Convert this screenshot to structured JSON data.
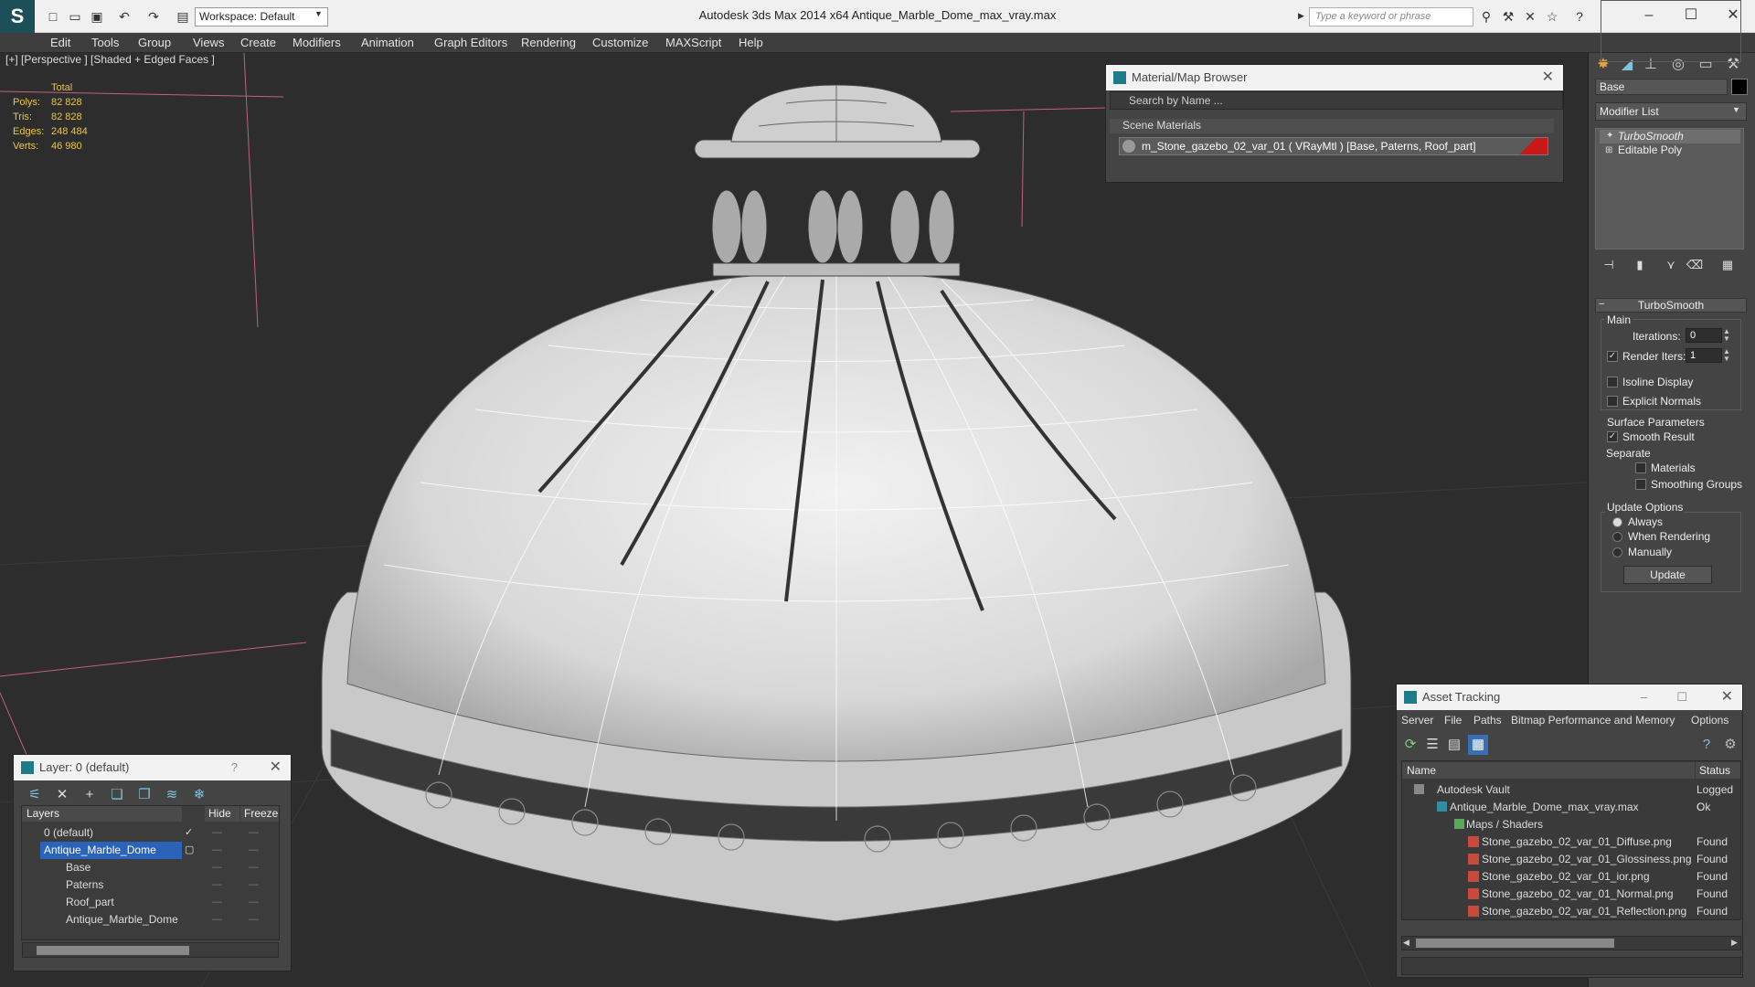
{
  "titlebar": {
    "title": "Autodesk 3ds Max  2014 x64     Antique_Marble_Dome_max_vray.max",
    "workspace": "Workspace: Default",
    "search_placeholder": "Type a keyword or phrase"
  },
  "menu": [
    "Edit",
    "Tools",
    "Group",
    "Views",
    "Create",
    "Modifiers",
    "Animation",
    "Graph Editors",
    "Rendering",
    "Customize",
    "MAXScript",
    "Help"
  ],
  "viewport": {
    "label": "[+] [Perspective ] [Shaded + Edged Faces ]",
    "stats": {
      "header": "Total",
      "rows": [
        {
          "label": "Polys:",
          "value": "82 828"
        },
        {
          "label": "Tris:",
          "value": "82 828"
        },
        {
          "label": "Edges:",
          "value": "248 484"
        },
        {
          "label": "Verts:",
          "value": "46 980"
        }
      ]
    }
  },
  "material_browser": {
    "title": "Material/Map Browser",
    "search_placeholder": "Search by Name ...",
    "section": "Scene Materials",
    "material": "m_Stone_gazebo_02_var_01  ( VRayMtl ) [Base, Paterns, Roof_part]",
    "swatch_color": "#c81818"
  },
  "command_panel": {
    "object_name": "Base",
    "modifier_list": "Modifier List",
    "stack": [
      "TurboSmooth",
      "Editable Poly"
    ],
    "rollout": "TurboSmooth",
    "main_group": "Main",
    "iterations_label": "Iterations:",
    "iterations": "0",
    "render_iters_label": "Render Iters:",
    "render_iters": "1",
    "render_iters_checked": true,
    "isoline": "Isoline Display",
    "explicit_normals": "Explicit Normals",
    "surface_group": "Surface Parameters",
    "smooth_result": "Smooth Result",
    "separate": "Separate",
    "materials": "Materials",
    "smoothing_groups": "Smoothing Groups",
    "update_group": "Update Options",
    "always": "Always",
    "when_rendering": "When Rendering",
    "manually": "Manually",
    "update_button": "Update"
  },
  "layer_panel": {
    "title": "Layer: 0 (default)",
    "help": "?",
    "col_layers": "Layers",
    "col_hide": "Hide",
    "col_freeze": "Freeze",
    "rows": [
      {
        "name": "0 (default)",
        "selected": false
      },
      {
        "name": "Antique_Marble_Dome",
        "selected": true
      },
      {
        "name": "Base",
        "selected": false
      },
      {
        "name": "Paterns",
        "selected": false
      },
      {
        "name": "Roof_part",
        "selected": false
      },
      {
        "name": "Antique_Marble_Dome",
        "selected": false
      }
    ]
  },
  "asset_tracking": {
    "title": "Asset Tracking",
    "menu": [
      "Server",
      "File",
      "Paths",
      "Bitmap Performance and Memory",
      "Options"
    ],
    "col_name": "Name",
    "col_status": "Status",
    "rows": [
      {
        "name": "Autodesk Vault",
        "status": "Logged C"
      },
      {
        "name": "Antique_Marble_Dome_max_vray.max",
        "status": "Ok"
      },
      {
        "name": "Maps / Shaders",
        "status": ""
      },
      {
        "name": "Stone_gazebo_02_var_01_Diffuse.png",
        "status": "Found"
      },
      {
        "name": "Stone_gazebo_02_var_01_Glossiness.png",
        "status": "Found"
      },
      {
        "name": "Stone_gazebo_02_var_01_ior.png",
        "status": "Found"
      },
      {
        "name": "Stone_gazebo_02_var_01_Normal.png",
        "status": "Found"
      },
      {
        "name": "Stone_gazebo_02_var_01_Reflection.png",
        "status": "Found"
      }
    ]
  }
}
